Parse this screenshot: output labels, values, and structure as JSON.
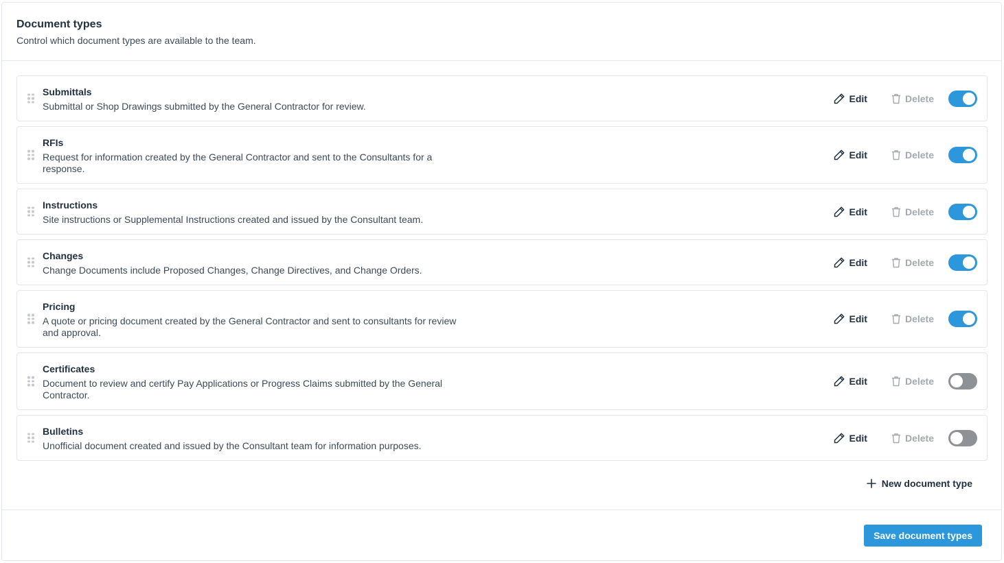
{
  "header": {
    "title": "Document types",
    "subtitle": "Control which document types are available to the team."
  },
  "actions": {
    "edit_label": "Edit",
    "delete_label": "Delete"
  },
  "document_types": [
    {
      "name": "Submittals",
      "description": "Submittal or Shop Drawings submitted by the General Contractor for review.",
      "enabled": true
    },
    {
      "name": "RFIs",
      "description": "Request for information created by the General Contractor and sent to the Consultants for a response.",
      "enabled": true
    },
    {
      "name": "Instructions",
      "description": "Site instructions or Supplemental Instructions created and issued by the Consultant team.",
      "enabled": true
    },
    {
      "name": "Changes",
      "description": "Change Documents include Proposed Changes, Change Directives, and Change Orders.",
      "enabled": true
    },
    {
      "name": "Pricing",
      "description": "A quote or pricing document created by the General Contractor and sent to consultants for review and approval.",
      "enabled": true
    },
    {
      "name": "Certificates",
      "description": "Document to review and certify Pay Applications or Progress Claims submitted by the General Contractor.",
      "enabled": false
    },
    {
      "name": "Bulletins",
      "description": "Unofficial document created and issued by the Consultant team for information purposes.",
      "enabled": false
    }
  ],
  "new_type_label": "New document type",
  "footer": {
    "save_label": "Save document types"
  },
  "colors": {
    "accent": "#2d97dc",
    "toggle_off": "#8e9296",
    "border": "#e3e6ea"
  }
}
